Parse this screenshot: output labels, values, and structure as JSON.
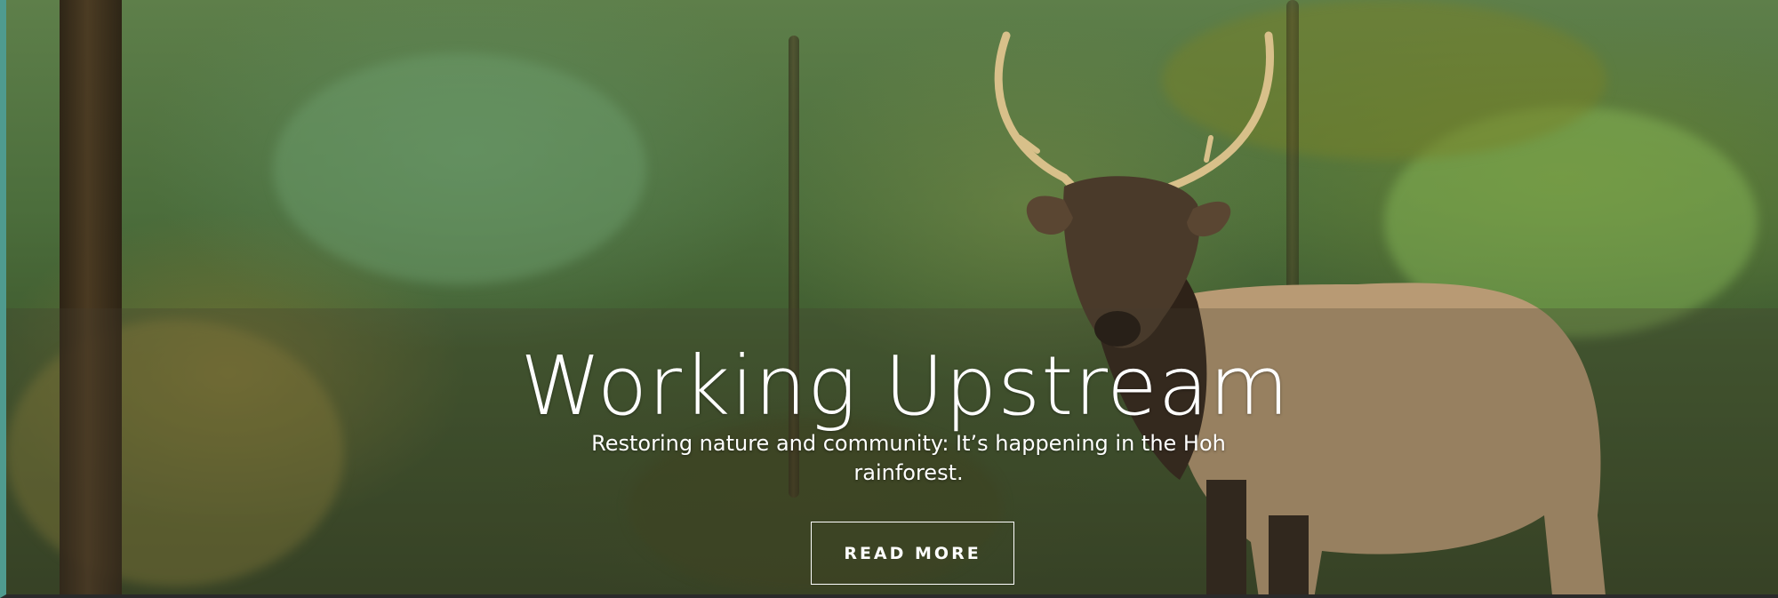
{
  "hero": {
    "title": "Working Upstream",
    "subtitle": "Restoring nature and community: It’s happening in the Hoh rainforest.",
    "button_label": "READ MORE",
    "image_subject": "elk-in-rainforest-photo"
  },
  "colors": {
    "accent_left_edge": "#4f9b8f",
    "text": "#ffffff",
    "band_overlay": "rgba(70,60,45,0.28)"
  }
}
